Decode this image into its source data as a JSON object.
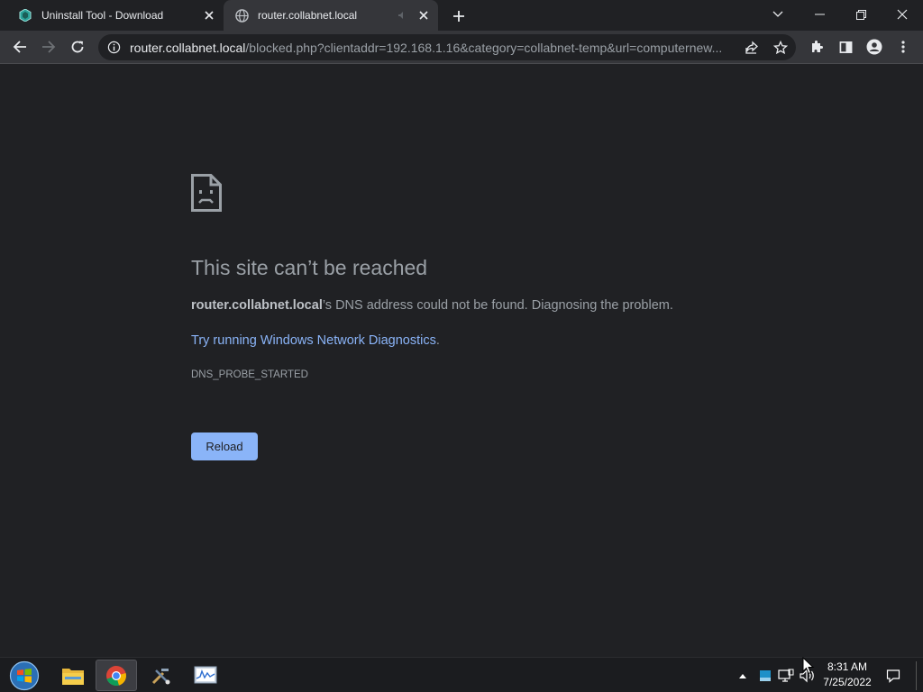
{
  "browser": {
    "tabs": [
      {
        "title": "Uninstall Tool - Download",
        "favicon": "uninstall-tool-icon",
        "active": false
      },
      {
        "title": "router.collabnet.local",
        "favicon": "globe-icon",
        "active": true
      }
    ],
    "url": {
      "host": "router.collabnet.local",
      "path": "/blocked.php?clientaddr=192.168.1.16&category=collabnet-temp&url=computernew..."
    }
  },
  "error_page": {
    "title": "This site can’t be reached",
    "host": "router.collabnet.local",
    "message": "’s DNS address could not be found. Diagnosing the problem.",
    "link_text": "Try running Windows Network Diagnostics",
    "link_suffix": ".",
    "error_code": "DNS_PROBE_STARTED",
    "reload_label": "Reload"
  },
  "taskbar": {
    "pinned": [
      "file-explorer-icon",
      "chrome-icon",
      "tools-icon",
      "performance-monitor-icon"
    ],
    "time": "8:31 AM",
    "date": "7/25/2022"
  },
  "colors": {
    "background": "#202124",
    "toolbar": "#35363a",
    "link": "#8ab4f8",
    "button": "#8ab4f8",
    "text": "#9aa0a6"
  }
}
